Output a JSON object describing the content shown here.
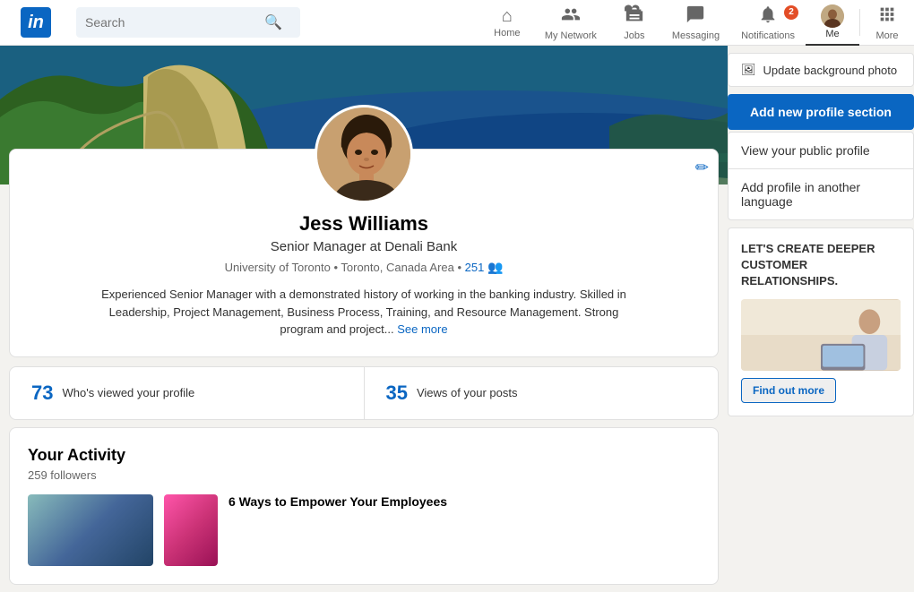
{
  "navbar": {
    "logo_text": "in",
    "search_placeholder": "Search",
    "nav_items": [
      {
        "id": "home",
        "label": "Home",
        "icon": "⌂",
        "active": false
      },
      {
        "id": "network",
        "label": "My Network",
        "icon": "👥",
        "active": false
      },
      {
        "id": "jobs",
        "label": "Jobs",
        "icon": "💼",
        "active": false
      },
      {
        "id": "messaging",
        "label": "Messaging",
        "icon": "💬",
        "active": false
      },
      {
        "id": "notifications",
        "label": "Notifications",
        "icon": "🔔",
        "badge": "2",
        "active": false
      },
      {
        "id": "me",
        "label": "Me",
        "icon": "avatar",
        "active": true
      },
      {
        "id": "more",
        "label": "More",
        "icon": "⋯",
        "active": false
      }
    ]
  },
  "profile": {
    "name": "Jess Williams",
    "title": "Senior Manager at Denali Bank",
    "university": "University of Toronto",
    "location": "Toronto, Canada Area",
    "connections": "251",
    "bio": "Experienced Senior Manager with a demonstrated history of working in the banking industry. Skilled in Leadership, Project Management, Business Process, Training, and Resource Management. Strong program and project...",
    "see_more": "See more",
    "edit_icon": "✏"
  },
  "stats": {
    "views_count": "73",
    "views_label": "Who's viewed your profile",
    "posts_count": "35",
    "posts_label": "Views of your posts"
  },
  "activity": {
    "title": "Your Activity",
    "followers": "259 followers",
    "article_title": "6 Ways to Empower Your Employees"
  },
  "right_panel": {
    "update_bg": "Update background photo",
    "add_section": "Add new profile section",
    "view_profile": "View your public profile",
    "add_language": "Add profile in another language",
    "ad": {
      "title": "LET'S CREATE DEEPER CUSTOMER RELATIONSHIPS.",
      "cta": "Find out more"
    }
  }
}
